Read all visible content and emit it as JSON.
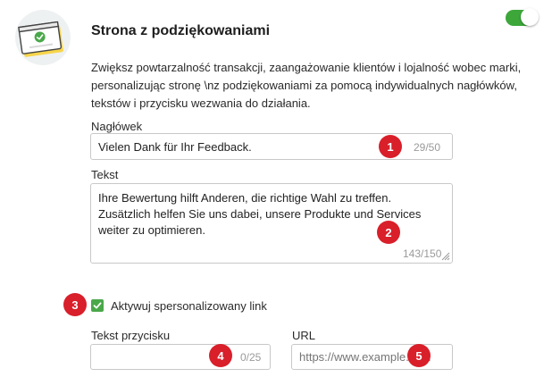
{
  "section": {
    "title": "Strona z podziękowaniami",
    "description": "Zwiększ powtarzalność transakcji, zaangażowanie klientów i lojalność wobec marki, personalizując stronę \\nz podziękowaniami za pomocą indywidualnych nagłówków, tekstów i przycisku wezwania do działania.",
    "toggle_enabled": true
  },
  "header_field": {
    "label": "Nagłówek",
    "value": "Vielen Dank für Ihr Feedback.",
    "counter": "29/50",
    "badge": "1"
  },
  "text_field": {
    "label": "Tekst",
    "value": "Ihre Bewertung hilft Anderen, die richtige Wahl zu treffen. Zusätzlich helfen Sie uns dabei, unsere Produkte und Services weiter zu optimieren.",
    "counter": "143/150",
    "badge": "2"
  },
  "link_checkbox": {
    "label": "Aktywuj spersonalizowany link",
    "checked": true,
    "badge": "3"
  },
  "button_text_field": {
    "label": "Tekst przycisku",
    "value": "",
    "counter": "0/25",
    "badge": "4"
  },
  "url_field": {
    "label": "URL",
    "placeholder": "https://www.example.com",
    "badge": "5"
  },
  "colors": {
    "accent_green": "#3da73a",
    "badge_red": "#d81f2a"
  }
}
